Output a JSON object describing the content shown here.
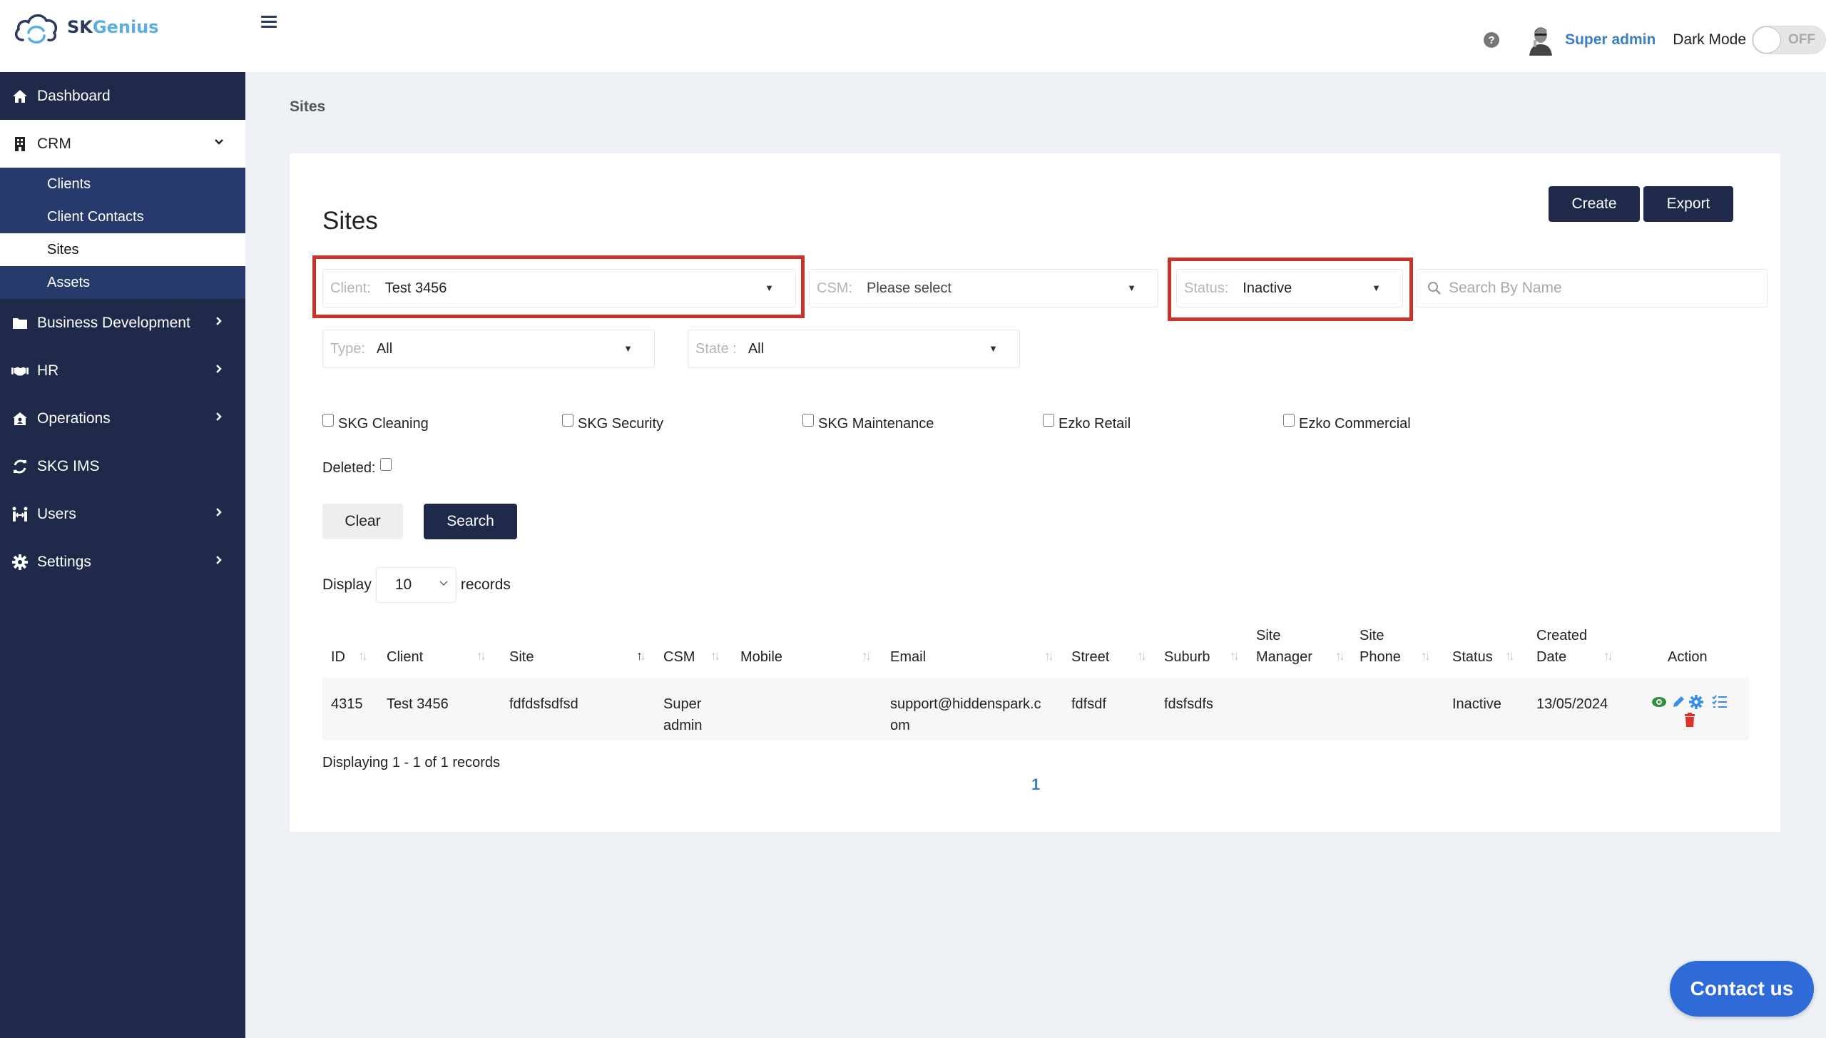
{
  "app": {
    "logo_sk": "SK",
    "logo_genius": "Genius"
  },
  "header": {
    "help_icon": "question-circle-icon",
    "username": "Super admin",
    "dark_mode_label": "Dark Mode",
    "dark_mode_state": "OFF"
  },
  "sidebar": {
    "items": [
      {
        "label": "Dashboard",
        "icon": "home-icon"
      },
      {
        "label": "CRM",
        "icon": "building-icon",
        "expanded": true
      },
      {
        "label": "Business Development",
        "icon": "folder-icon"
      },
      {
        "label": "HR",
        "icon": "handshake-icon"
      },
      {
        "label": "Operations",
        "icon": "house-user-icon"
      },
      {
        "label": "SKG IMS",
        "icon": "sync-icon"
      },
      {
        "label": "Users",
        "icon": "users-icon"
      },
      {
        "label": "Settings",
        "icon": "gear-icon"
      }
    ],
    "crm_sub": [
      {
        "label": "Clients"
      },
      {
        "label": "Client Contacts"
      },
      {
        "label": "Sites",
        "active": true
      },
      {
        "label": "Assets"
      }
    ]
  },
  "breadcrumb": "Sites",
  "page": {
    "title": "Sites",
    "create_label": "Create",
    "export_label": "Export"
  },
  "filters": {
    "client": {
      "label": "Client:",
      "value": "Test 3456"
    },
    "csm": {
      "label": "CSM:",
      "value": "Please select"
    },
    "status": {
      "label": "Status:",
      "value": "Inactive"
    },
    "search_placeholder": "Search By Name",
    "type": {
      "label": "Type:",
      "value": "All"
    },
    "state": {
      "label": "State :",
      "value": "All"
    },
    "checkboxes": [
      {
        "label": "SKG Cleaning",
        "checked": false
      },
      {
        "label": "SKG Security",
        "checked": false
      },
      {
        "label": "SKG Maintenance",
        "checked": false
      },
      {
        "label": "Ezko Retail",
        "checked": false
      },
      {
        "label": "Ezko Commercial",
        "checked": false
      }
    ],
    "deleted_label": "Deleted:",
    "clear_label": "Clear",
    "search_label": "Search"
  },
  "display": {
    "prefix": "Display",
    "value": "10",
    "suffix": "records"
  },
  "table": {
    "columns": [
      {
        "h1": "",
        "h2": "ID"
      },
      {
        "h1": "",
        "h2": "Client"
      },
      {
        "h1": "",
        "h2": "Site"
      },
      {
        "h1": "",
        "h2": "CSM"
      },
      {
        "h1": "",
        "h2": "Mobile"
      },
      {
        "h1": "",
        "h2": "Email"
      },
      {
        "h1": "",
        "h2": "Street"
      },
      {
        "h1": "",
        "h2": "Suburb"
      },
      {
        "h1": "Site",
        "h2": "Manager"
      },
      {
        "h1": "Site",
        "h2": "Phone"
      },
      {
        "h1": "",
        "h2": "Status"
      },
      {
        "h1": "Created",
        "h2": "Date"
      },
      {
        "h1": "",
        "h2": "Action"
      }
    ],
    "rows": [
      {
        "id": "4315",
        "client": "Test 3456",
        "site": "fdfdsfsdfsd",
        "csm_1": "Super",
        "csm_2": "admin",
        "mobile": "",
        "email_1": "support@hiddenspark.c",
        "email_2": "om",
        "street": "fdfsdf",
        "suburb": "fdsfsdfs",
        "site_manager": "",
        "site_phone": "",
        "status": "Inactive",
        "created_date": "13/05/2024",
        "actions": [
          "view-icon",
          "edit-icon",
          "gear-icon",
          "checklist-icon",
          "trash-icon"
        ]
      }
    ]
  },
  "pagination": {
    "info": "Displaying 1 - 1 of 1 records",
    "current_page": "1"
  },
  "contact_label": "Contact us",
  "colors": {
    "sidebar": "#1f2a4a",
    "submenu": "#263a6c",
    "primary_button": "#1f2a4a",
    "highlight": "#c8342b",
    "link": "#3a7fc0",
    "contact": "#2f6ad9"
  }
}
